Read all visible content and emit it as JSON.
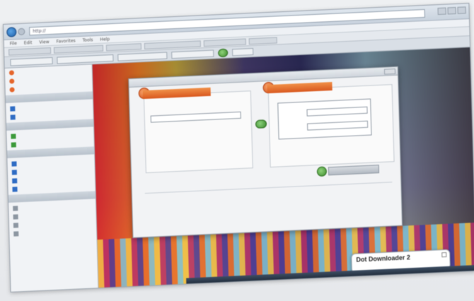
{
  "browser": {
    "address": "http://",
    "menu": [
      "File",
      "Edit",
      "View",
      "Favorites",
      "Tools",
      "Help"
    ],
    "bookmarks": [
      "",
      "",
      "",
      "",
      "",
      ""
    ],
    "toolbar": [
      "",
      "",
      "",
      "",
      ""
    ]
  },
  "sidebar": {
    "sections": [
      {
        "head": "",
        "items": [
          {
            "label": "",
            "icon": "orange"
          },
          {
            "label": "",
            "icon": "orange"
          },
          {
            "label": "",
            "icon": "orange"
          }
        ]
      },
      {
        "head": "",
        "items": [
          {
            "label": "",
            "icon": "blue"
          },
          {
            "label": "",
            "icon": "blue"
          }
        ]
      },
      {
        "head": "",
        "items": [
          {
            "label": "",
            "icon": "green"
          },
          {
            "label": "",
            "icon": "green"
          }
        ]
      },
      {
        "head": "",
        "items": [
          {
            "label": "",
            "icon": "blue"
          },
          {
            "label": "",
            "icon": "blue"
          },
          {
            "label": "",
            "icon": "blue"
          },
          {
            "label": "",
            "icon": "blue"
          }
        ]
      },
      {
        "head": "",
        "items": [
          {
            "label": "",
            "icon": "gray"
          },
          {
            "label": "",
            "icon": "gray"
          },
          {
            "label": "",
            "icon": "gray"
          },
          {
            "label": "",
            "icon": "gray"
          }
        ]
      }
    ]
  },
  "dialog": {
    "title": "",
    "left_panel_title": "",
    "left_input": "",
    "right_panel_title": "",
    "right_field1_label": "",
    "right_field1_value": "",
    "right_field2_label": "",
    "right_field2_value": "",
    "go_button": "",
    "links_left": [
      "",
      "",
      "",
      ""
    ],
    "links_right": [
      "",
      ""
    ]
  },
  "notification": {
    "title": "Dot Downloader 2",
    "subtitle": ""
  },
  "colors": {
    "accent_orange": "#e5652b",
    "go_green": "#3c8b2c",
    "link_blue": "#2752b0"
  }
}
